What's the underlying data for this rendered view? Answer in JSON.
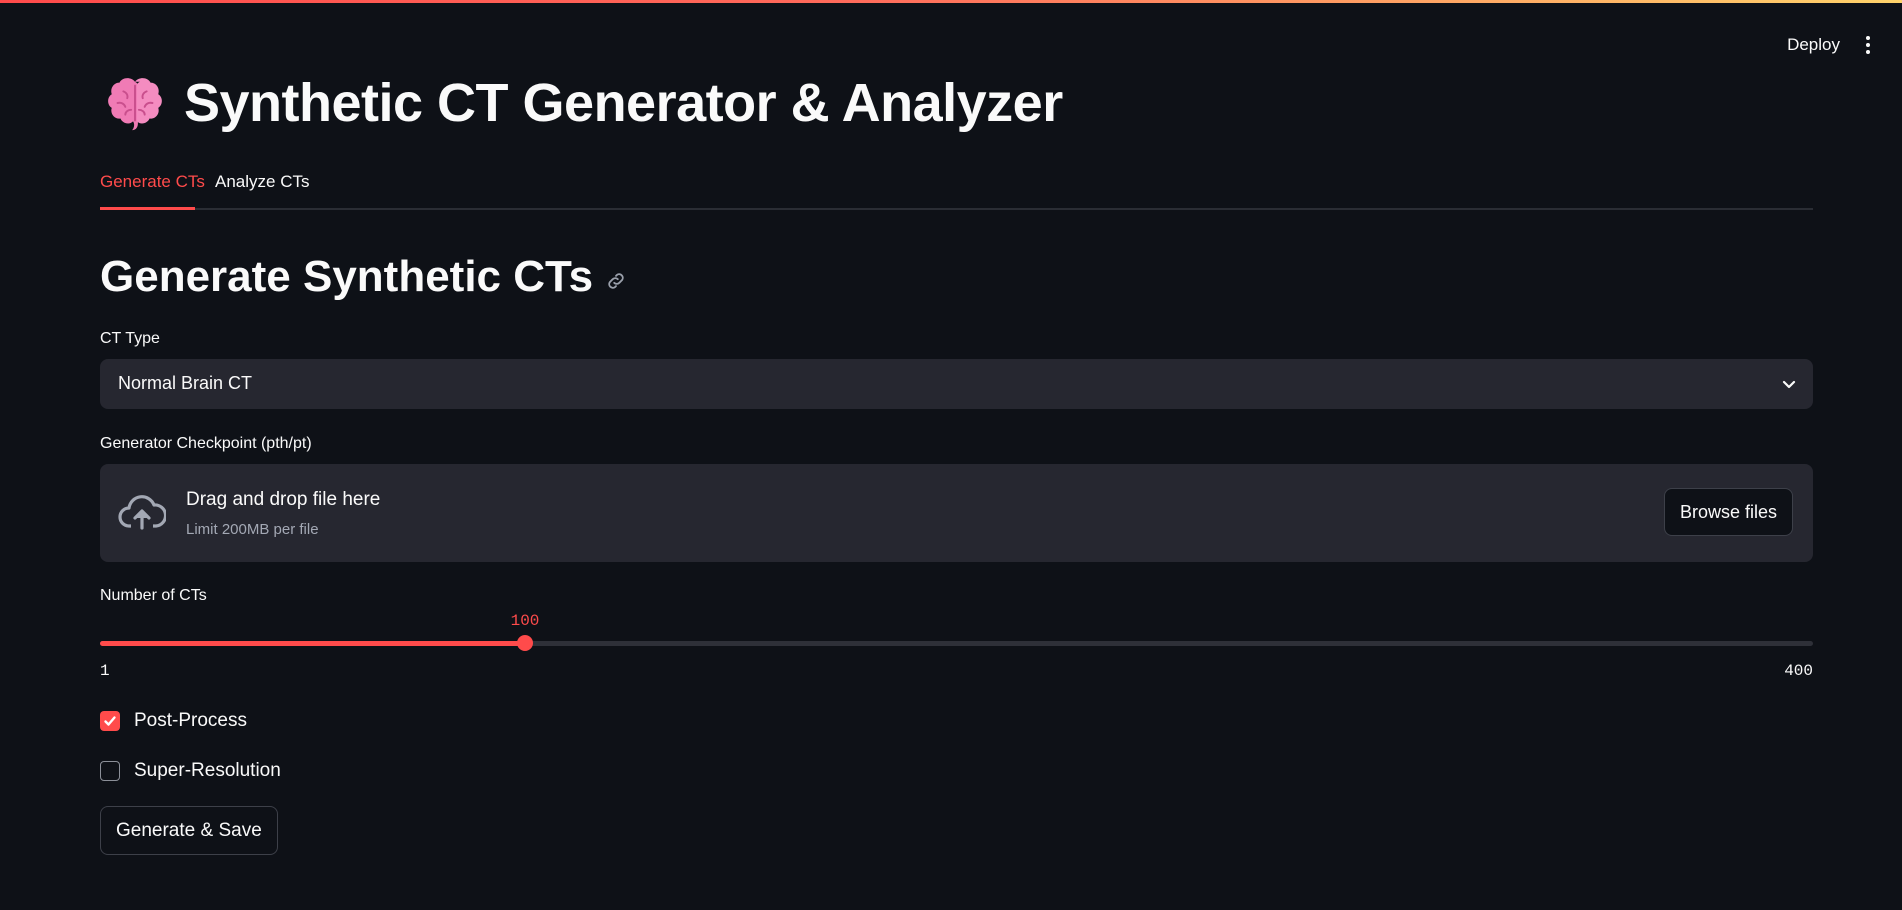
{
  "header": {
    "deploy_label": "Deploy"
  },
  "page": {
    "title": "Synthetic CT Generator & Analyzer"
  },
  "tabs": [
    {
      "label": "Generate CTs",
      "active": true
    },
    {
      "label": "Analyze CTs",
      "active": false
    }
  ],
  "section": {
    "title": "Generate Synthetic CTs"
  },
  "ct_type": {
    "label": "CT Type",
    "selected": "Normal Brain CT"
  },
  "uploader": {
    "label": "Generator Checkpoint (pth/pt)",
    "drop_title": "Drag and drop file here",
    "drop_subtitle": "Limit 200MB per file",
    "browse_label": "Browse files"
  },
  "slider": {
    "label": "Number of CTs",
    "value": 100,
    "min": 1,
    "max": 400
  },
  "checkboxes": [
    {
      "label": "Post-Process",
      "checked": true
    },
    {
      "label": "Super-Resolution",
      "checked": false
    }
  ],
  "actions": {
    "generate_label": "Generate & Save"
  },
  "colors": {
    "accent": "#ff4b4b",
    "background": "#0e1117",
    "widget": "#262730"
  }
}
